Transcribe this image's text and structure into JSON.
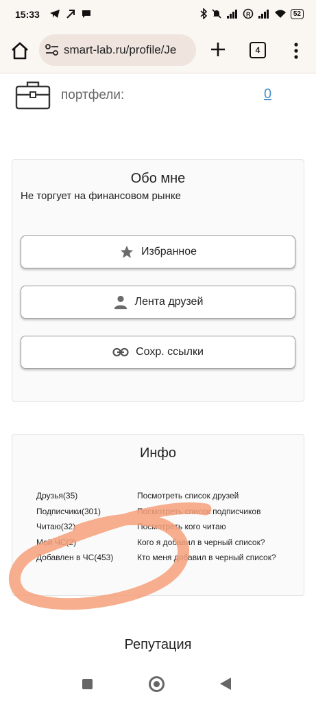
{
  "status_bar": {
    "time": "15:33",
    "battery": "52",
    "icons": [
      "telegram-icon",
      "arrow-icon",
      "chat-icon",
      "bluetooth-icon",
      "mute-icon",
      "signal-icon",
      "r-icon",
      "signal-icon",
      "wifi-icon",
      "battery-icon"
    ]
  },
  "browser": {
    "url": "smart-lab.ru/profile/Je",
    "tab_count": "4"
  },
  "portfolio": {
    "label": "портфели:",
    "value": "0"
  },
  "about": {
    "title": "Обо мне",
    "text": "Не торгует на финансовом рынке",
    "buttons": [
      {
        "label": "Избранное",
        "icon": "star-icon"
      },
      {
        "label": "Лента друзей",
        "icon": "person-icon"
      },
      {
        "label": "Сохр. ссылки",
        "icon": "link-icon"
      }
    ]
  },
  "info": {
    "title": "Инфо",
    "rows": [
      {
        "left": "Друзья(35)",
        "right": "Посмотреть список друзей"
      },
      {
        "left": "Подписчики(301)",
        "right": "Посмотреть список подписчиков"
      },
      {
        "left": "Читаю(32)",
        "right": "Посмотреть кого читаю"
      },
      {
        "left": "Мой ЧС(2)",
        "right": "Кого я добавил в черный список?"
      },
      {
        "left": "Добавлен в ЧС(453)",
        "right": "Кто меня добавил в черный список?"
      }
    ]
  },
  "reputation": {
    "title": "Репутация"
  },
  "colors": {
    "link": "#4a8fc7",
    "annotation": "#f4a07a",
    "chrome_bg": "#faf6f2"
  }
}
